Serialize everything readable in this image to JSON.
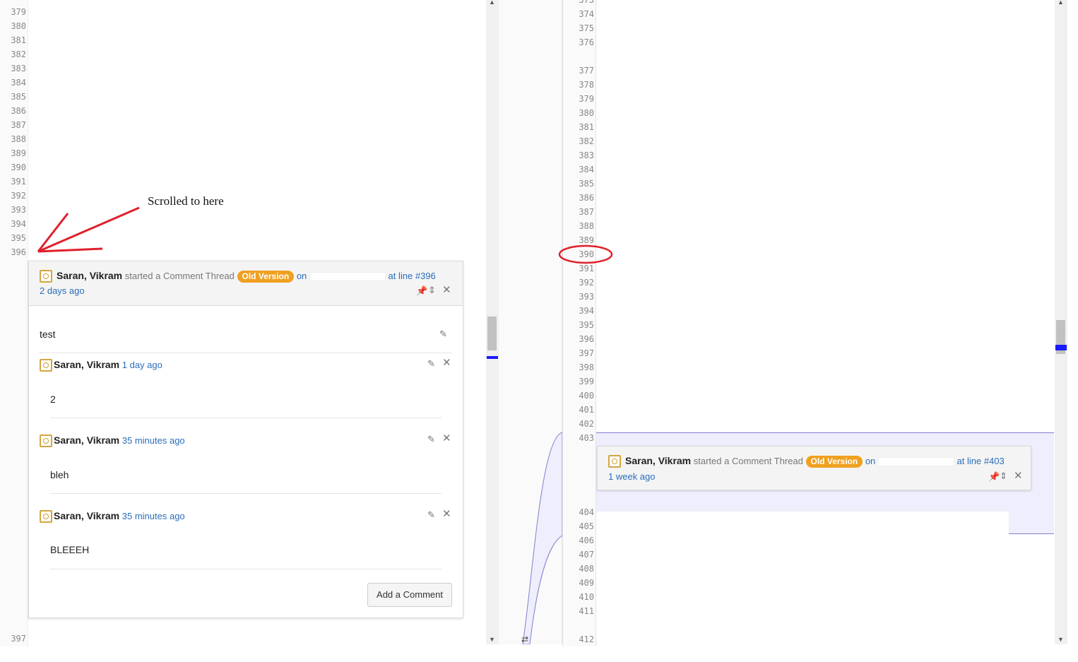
{
  "left_pane": {
    "line_numbers": [
      "379",
      "380",
      "381",
      "382",
      "383",
      "384",
      "385",
      "386",
      "387",
      "388",
      "389",
      "390",
      "391",
      "392",
      "393",
      "394",
      "395",
      "396"
    ],
    "trailing_line": "397"
  },
  "right_pane": {
    "line_numbers_a": [
      "373",
      "374",
      "375",
      "376"
    ],
    "line_numbers_b": [
      "377",
      "378",
      "379",
      "380",
      "381",
      "382",
      "383",
      "384",
      "385",
      "386",
      "387",
      "388",
      "389",
      "390",
      "391",
      "392",
      "393",
      "394",
      "395",
      "396",
      "397",
      "398",
      "399",
      "400",
      "401",
      "402",
      "403"
    ],
    "line_numbers_c": [
      "404",
      "405",
      "406",
      "407",
      "408",
      "409",
      "410",
      "411"
    ],
    "trailing_line": "412"
  },
  "annotation": {
    "label": "Scrolled to here",
    "color": "#e0202a"
  },
  "left_thread": {
    "author": "Saran, Vikram",
    "started_text": "started a Comment Thread",
    "badge": "Old Version",
    "on_text": "on",
    "line_ref": "at line #396",
    "time": "2 days ago",
    "first_comment": "test",
    "replies": [
      {
        "author": "Saran, Vikram",
        "time": "1 day ago",
        "text": "2"
      },
      {
        "author": "Saran, Vikram",
        "time": "35 minutes ago",
        "text": "bleh"
      },
      {
        "author": "Saran, Vikram",
        "time": "35 minutes ago",
        "text": "BLEEEH"
      }
    ],
    "add_button": "Add a Comment"
  },
  "right_thread": {
    "author": "Saran, Vikram",
    "started_text": "started a Comment Thread",
    "badge": "Old Version",
    "on_text": "on",
    "line_ref": "at line #403",
    "time": "1 week ago"
  },
  "icons": {
    "pin": "pin-icon",
    "expand": "expand-icon",
    "close": "close-icon",
    "edit": "pencil-icon"
  },
  "colors": {
    "badge": "#f0a020",
    "link": "#2a6ebb",
    "scroll_marker": "#1a1aff",
    "diff_band": "#eeeefc"
  }
}
